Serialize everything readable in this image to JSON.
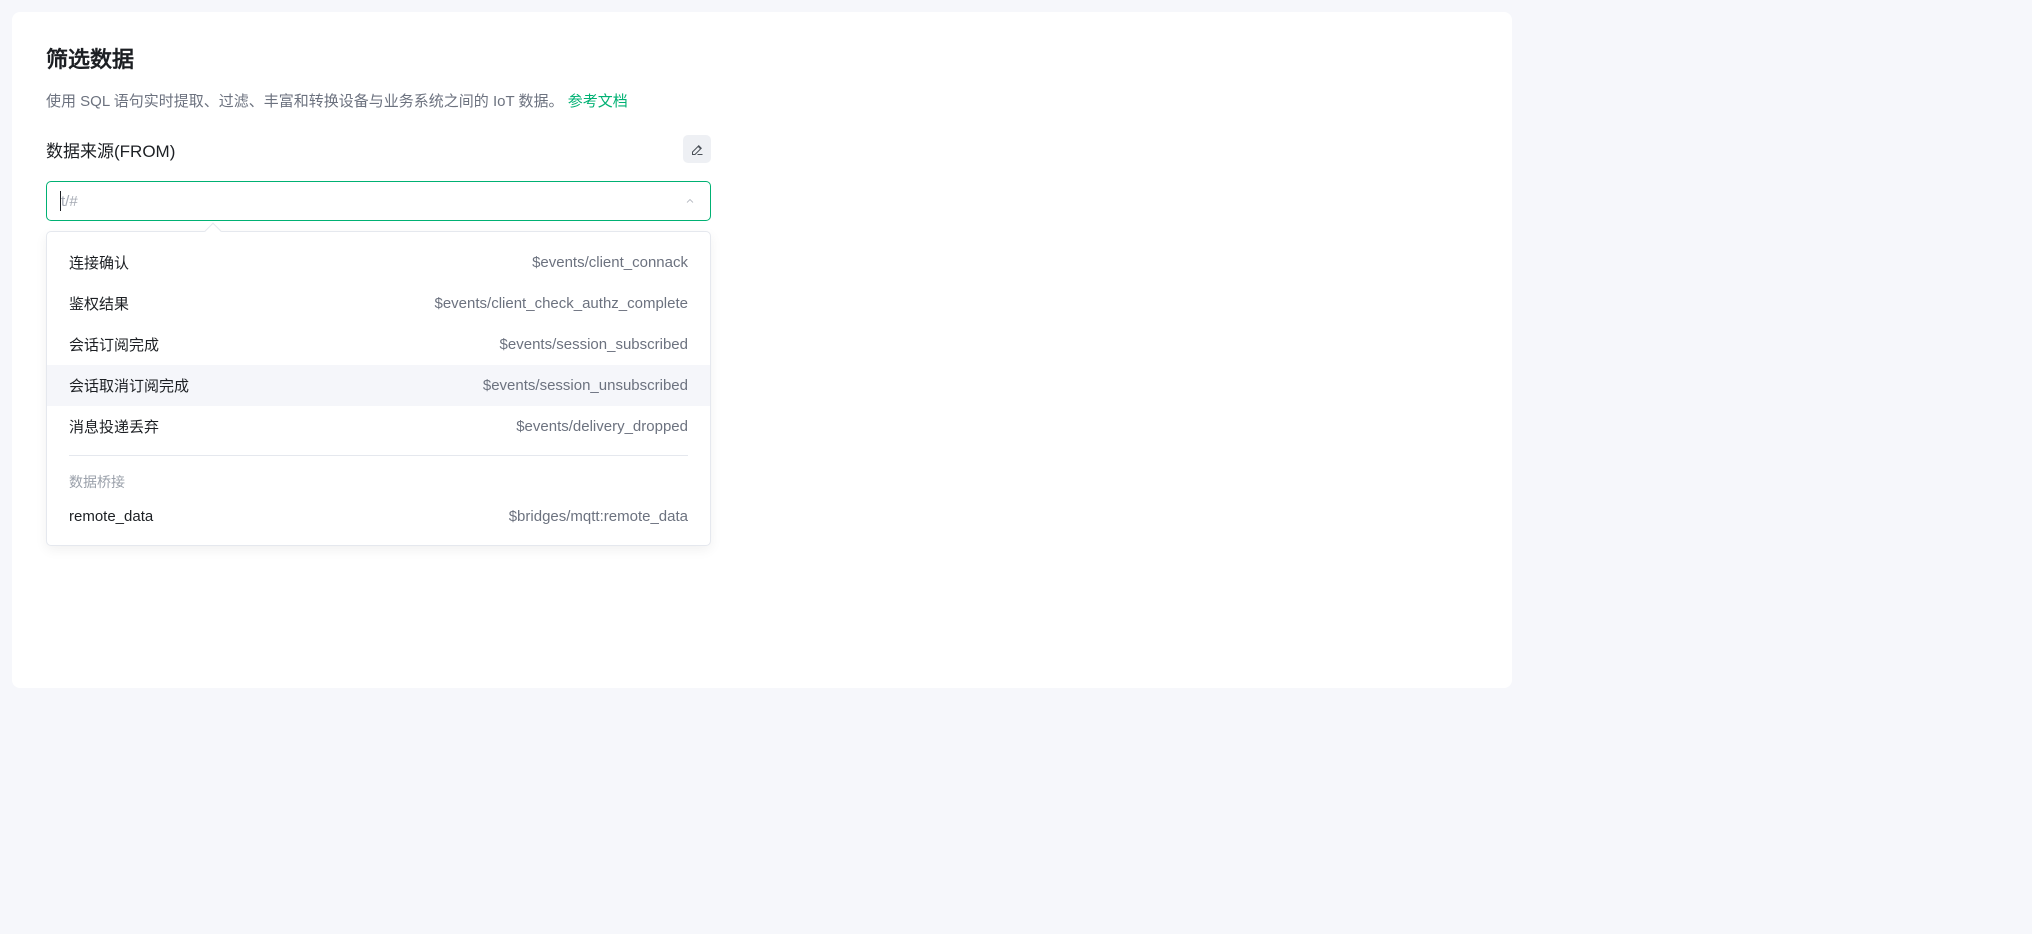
{
  "card": {
    "title": "筛选数据",
    "subtitle_text": "使用 SQL 语句实时提取、过滤、丰富和转换设备与业务系统之间的 IoT 数据。",
    "doc_link_label": "参考文档",
    "section_label": "数据来源(FROM)"
  },
  "select": {
    "placeholder": "t/#"
  },
  "dropdown": {
    "items": [
      {
        "label": "连接确认",
        "value": "$events/client_connack"
      },
      {
        "label": "鉴权结果",
        "value": "$events/client_check_authz_complete"
      },
      {
        "label": "会话订阅完成",
        "value": "$events/session_subscribed"
      },
      {
        "label": "会话取消订阅完成",
        "value": "$events/session_unsubscribed"
      },
      {
        "label": "消息投递丢弃",
        "value": "$events/delivery_dropped"
      }
    ],
    "group_label": "数据桥接",
    "bridge_items": [
      {
        "label": "remote_data",
        "value": "$bridges/mqtt:remote_data"
      }
    ],
    "hovered_index": 3
  }
}
